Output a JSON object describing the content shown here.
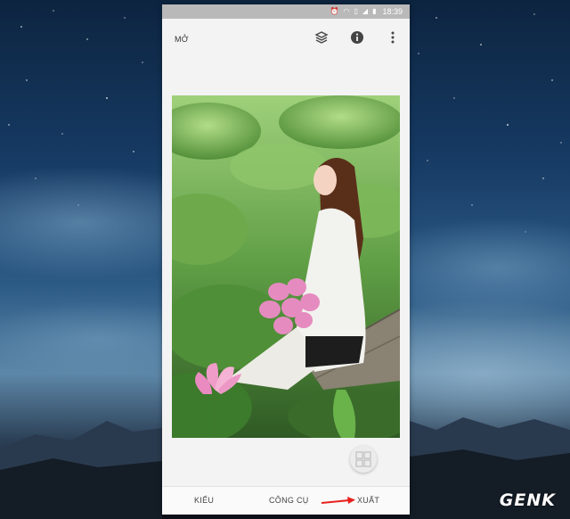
{
  "status_bar": {
    "time": "18:39",
    "icons": [
      "alarm-icon",
      "wifi-icon",
      "data-icon",
      "signal-icon",
      "battery-icon"
    ]
  },
  "app_bar": {
    "open_label": "MỞ",
    "actions": [
      "layers-icon",
      "info-icon",
      "more-vert-icon"
    ]
  },
  "bottom_tabs": {
    "styles": "KIỂU",
    "tools": "CÔNG CỤ",
    "export": "XUẤT"
  },
  "fab": {
    "icon": "grid-icon"
  },
  "annotation": {
    "color": "#e8211e"
  },
  "watermark": {
    "text": "GENK"
  },
  "colors": {
    "status_bar": "#b9b9b9",
    "app_background": "#f3f3f3"
  }
}
